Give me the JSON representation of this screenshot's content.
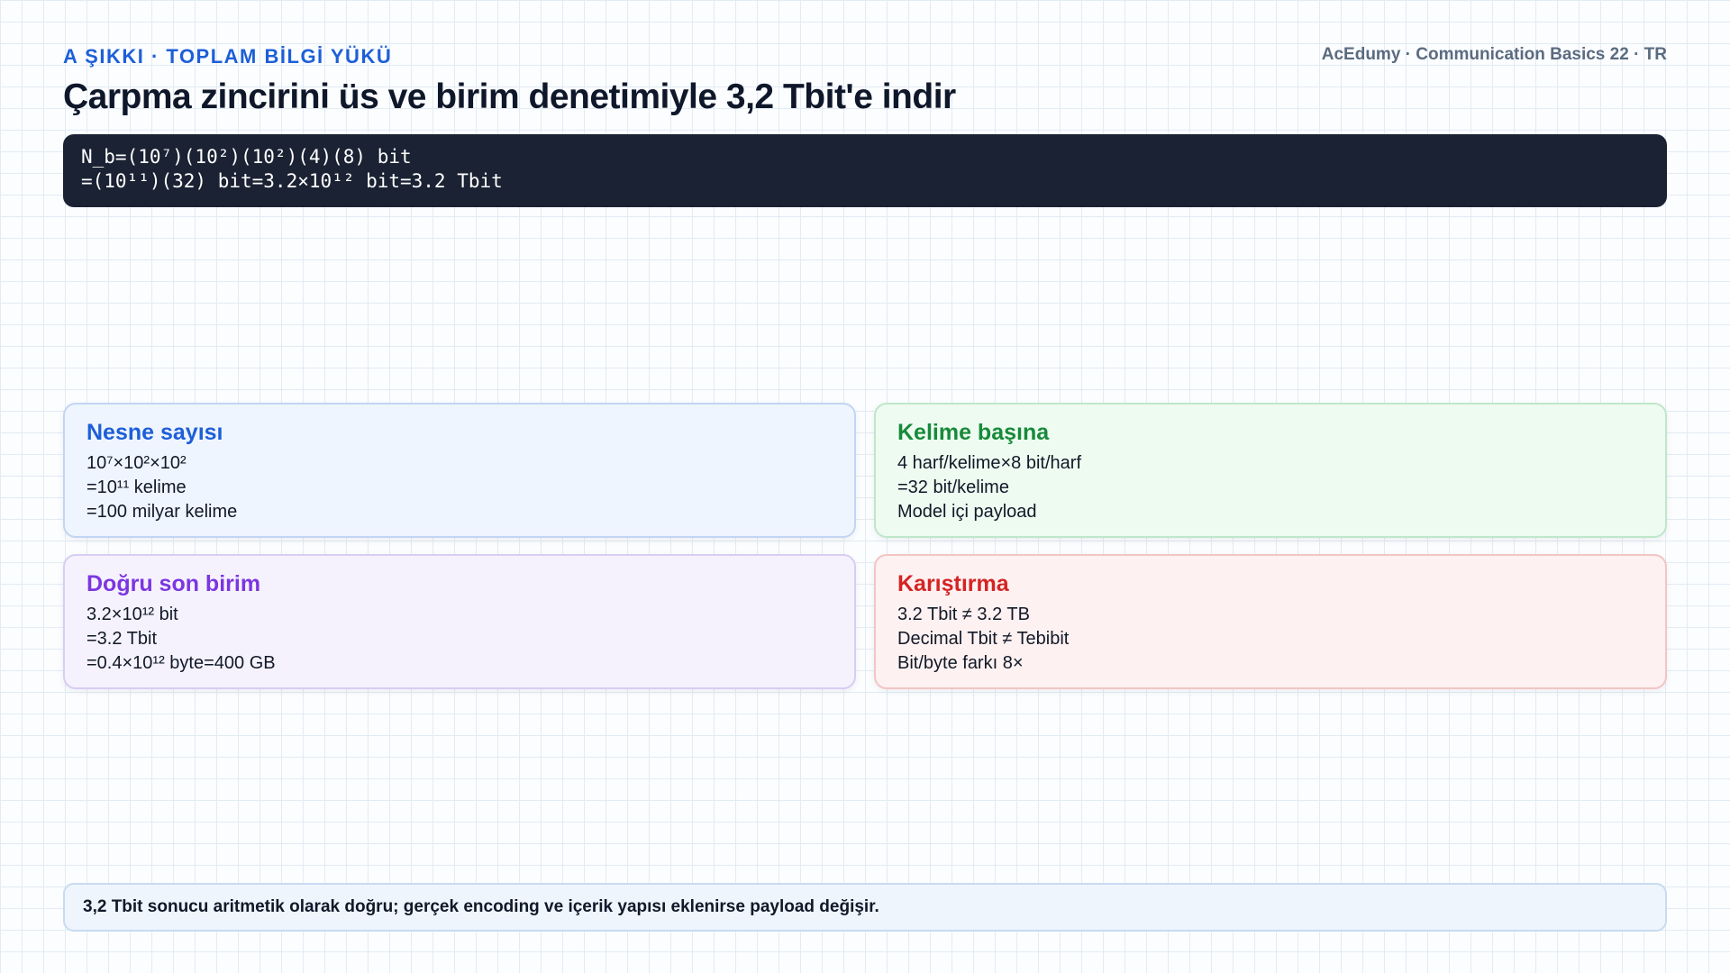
{
  "header": {
    "eyebrow": "A ŞIKKI · TOPLAM BİLGİ YÜKÜ",
    "brand": "AcEdumy · Communication Basics 22 · TR",
    "title": "Çarpma zincirini üs ve birim denetimiyle 3,2 Tbit'e indir"
  },
  "formula": {
    "lines": [
      "N_b=(10⁷)(10²)(10²)(4)(8) bit",
      "=(10¹¹)(32) bit=3.2×10¹² bit=3.2 Tbit"
    ]
  },
  "cards": [
    {
      "title": "Nesne sayısı",
      "lines": [
        "10⁷×10²×10²",
        "=10¹¹ kelime",
        "=100 milyar kelime"
      ],
      "accent": "#1d5fd8"
    },
    {
      "title": "Kelime başına",
      "lines": [
        "4 harf/kelime×8 bit/harf",
        "=32 bit/kelime",
        "Model içi payload"
      ],
      "accent": "#178a3a"
    },
    {
      "title": "Doğru son birim",
      "lines": [
        "3.2×10¹² bit",
        "=3.2 Tbit",
        "=0.4×10¹² byte=400 GB"
      ],
      "accent": "#7c36e0"
    },
    {
      "title": "Karıştırma",
      "lines": [
        "3.2 Tbit ≠ 3.2 TB",
        "Decimal Tbit ≠ Tebibit",
        "Bit/byte farkı 8×"
      ],
      "accent": "#d42424"
    }
  ],
  "note": {
    "text": "3,2 Tbit sonucu aritmetik olarak doğru; gerçek encoding ve içerik yapısı eklenirse payload değişir."
  }
}
